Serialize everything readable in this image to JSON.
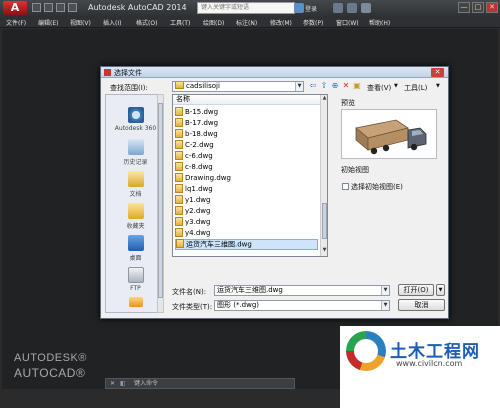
{
  "window": {
    "app_logo": "A",
    "title": "Autodesk AutoCAD 2014",
    "search_placeholder": "键入关键字或短语",
    "login": "登录",
    "minimize": "—",
    "maximize": "□",
    "close": "✕"
  },
  "menu": [
    "文件(F)",
    "编辑(E)",
    "视图(V)",
    "插入(I)",
    "格式(O)",
    "工具(T)",
    "绘图(D)",
    "标注(N)",
    "修改(M)",
    "参数(P)",
    "窗口(W)",
    "帮助(H)"
  ],
  "dialog": {
    "title": "选择文件",
    "close": "✕",
    "lookin_label": "查找范围(I):",
    "lookin_value": "cadsilisoji",
    "view_label": "查看(V)",
    "tools_label": "工具(L)",
    "places": [
      {
        "label": "Autodesk 360",
        "icon": "cloud-icon"
      },
      {
        "label": "历史记录",
        "icon": "history-icon"
      },
      {
        "label": "文档",
        "icon": "documents-icon"
      },
      {
        "label": "收藏夹",
        "icon": "favorites-icon"
      },
      {
        "label": "桌面",
        "icon": "desktop-icon"
      },
      {
        "label": "FTP",
        "icon": "ftp-icon"
      }
    ],
    "column_header": "名称",
    "files": [
      "B-15.dwg",
      "B-17.dwg",
      "b-18.dwg",
      "C-2.dwg",
      "c-6.dwg",
      "c-8.dwg",
      "Drawing.dwg",
      "lq1.dwg",
      "y1.dwg",
      "y2.dwg",
      "y3.dwg",
      "y4.dwg",
      "运货汽车三维图.dwg"
    ],
    "selected_file_index": 12,
    "preview_label": "预览",
    "initial_view_label": "初始视图",
    "initial_view_checkbox": "选择初始视图(E)",
    "filename_label": "文件名(N):",
    "filename_value": "运货汽车三维图.dwg",
    "filetype_label": "文件类型(T):",
    "filetype_value": "图形 (*.dwg)",
    "open_button": "打开(O)",
    "cancel_button": "取消"
  },
  "autodesk_brand": {
    "line1": "AUTODESK®",
    "line2": "AUTOCAD®"
  },
  "command_line": {
    "close": "✕",
    "placeholder": "键入命令"
  },
  "watermark": {
    "title": "土木工程网",
    "url": "www.civilcn.com"
  }
}
